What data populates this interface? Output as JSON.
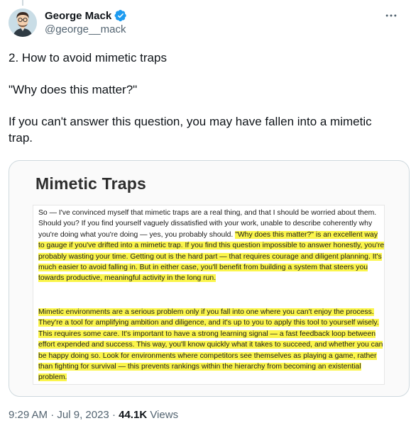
{
  "author": {
    "name": "George Mack",
    "handle": "@george__mack",
    "verified": true
  },
  "tweet": {
    "paragraphs": [
      "2. How to avoid mimetic traps",
      "\"Why does this matter?\"",
      "If you can't answer this question, you may have fallen into a mimetic trap."
    ]
  },
  "image": {
    "title": "Mimetic Traps",
    "para1_plain": "So — I've convinced myself that mimetic traps are a real thing, and that I should be worried about them. Should you? If you find yourself vaguely dissatisfied with your work, unable to describe coherently why you're doing what you're doing — yes, you probably should. ",
    "para1_highlight": "\"Why does this matter?\" is an excellent way to gauge if you've drifted into a mimetic trap. If you find this question impossible to answer honestly, you're probably wasting your time. Getting out is the hard part — that requires courage and diligent planning. It's much easier to avoid falling in. But in either case, you'll benefit from building a system that steers you towards productive, meaningful activity in the long run.",
    "para2_highlight": "Mimetic environments are a serious problem only if you fall into one where you can't enjoy the process. They're a tool for amplifying ambition and diligence, and it's up to you to apply this tool to yourself wisely. This requires some care. It's important to have a strong learning signal — a fast feedback loop between effort expended and success. This way, you'll know quickly what it takes to succeed, and whether you can be happy doing so. Look for environments where competitors see themselves as playing a game, rather than fighting for survival — this prevents rankings within the hierarchy from becoming an existential problem.",
    "highlight_color": "#fbf54c"
  },
  "meta": {
    "time": "9:29 AM",
    "separator": " · ",
    "date": "Jul 9, 2023",
    "views_count": "44.1K",
    "views_label": " Views"
  },
  "colors": {
    "verified_blue": "#1d9bf0",
    "secondary_text": "#536471",
    "primary_text": "#0f1419"
  },
  "icons": [
    "verified-badge-icon",
    "more-options-icon"
  ]
}
